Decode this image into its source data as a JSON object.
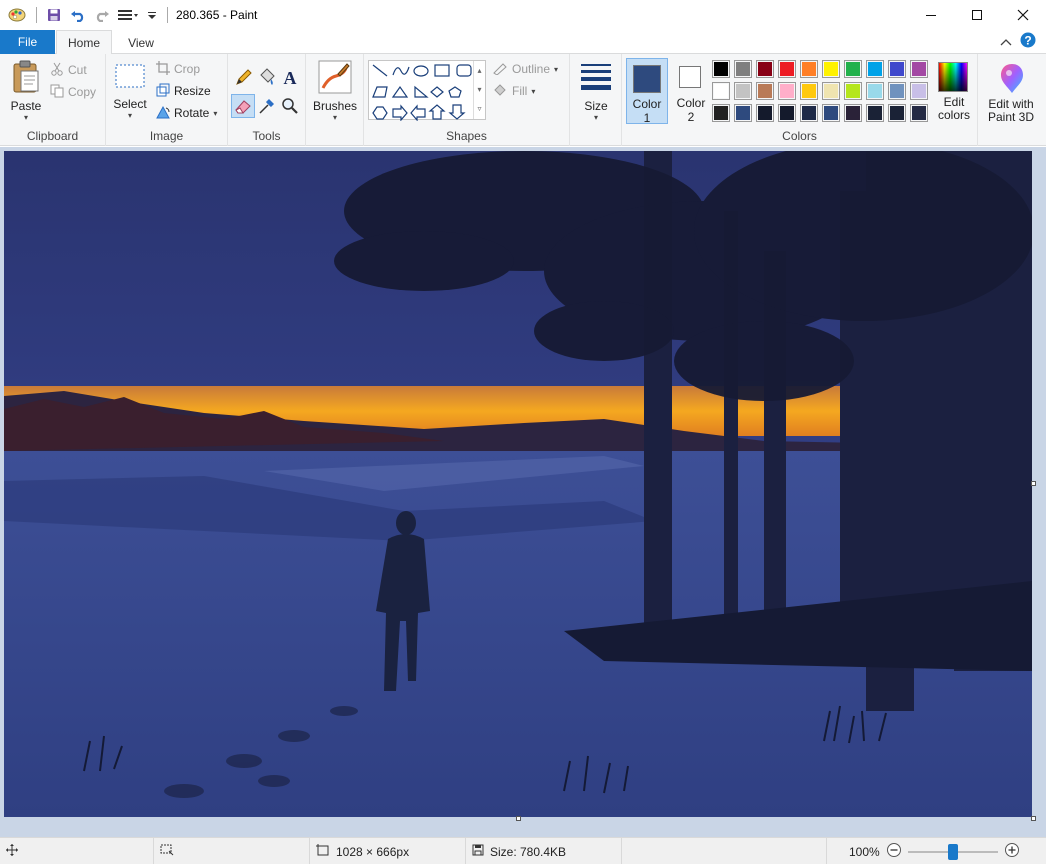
{
  "window": {
    "title": "280.365 - Paint"
  },
  "tabs": {
    "file": "File",
    "home": "Home",
    "view": "View"
  },
  "ribbon": {
    "clipboard": {
      "label": "Clipboard",
      "paste": "Paste",
      "cut": "Cut",
      "copy": "Copy"
    },
    "image": {
      "label": "Image",
      "select": "Select",
      "crop": "Crop",
      "resize": "Resize",
      "rotate": "Rotate"
    },
    "tools": {
      "label": "Tools"
    },
    "brushes": {
      "label": "Brushes"
    },
    "shapes": {
      "label": "Shapes",
      "outline": "Outline",
      "fill": "Fill"
    },
    "size": {
      "label": "Size"
    },
    "colors": {
      "label": "Colors",
      "color1_line1": "Color",
      "color1_line2": "1",
      "color2_line1": "Color",
      "color2_line2": "2",
      "edit_line1": "Edit",
      "edit_line2": "colors",
      "paint3d_line1": "Edit with",
      "paint3d_line2": "Paint 3D",
      "color1_value": "#2e4a7e",
      "color2_value": "#ffffff",
      "palette_row1": [
        "#000000",
        "#7f7f7f",
        "#880015",
        "#ed1c24",
        "#ff7f27",
        "#fff200",
        "#22b14c",
        "#00a2e8",
        "#3f48cc",
        "#a349a4"
      ],
      "palette_row2": [
        "#ffffff",
        "#c3c3c3",
        "#b97a57",
        "#ffaec9",
        "#ffc90e",
        "#efe4b0",
        "#b5e61d",
        "#99d9ea",
        "#7092be",
        "#c8bfe7"
      ],
      "palette_row3": [
        "#222222",
        "#2e4a7e",
        "#141a2c",
        "#141a2c",
        "#1e2a48",
        "#2e4a7e",
        "#2a2238",
        "#1a2236",
        "#1a2236",
        "#242a44"
      ]
    }
  },
  "status": {
    "dimensions": "1028 × 666px",
    "size": "Size: 780.4KB",
    "zoom": "100%",
    "zoom_level": 0.5
  }
}
